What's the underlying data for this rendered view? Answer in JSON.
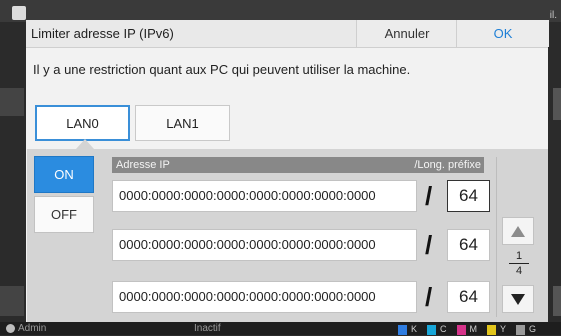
{
  "background": {
    "corner_text": "il."
  },
  "status_bar": {
    "user": "Admin",
    "state": "Inactif",
    "inks": [
      {
        "label": "K",
        "color": "#2f7de1"
      },
      {
        "label": "C",
        "color": "#18a6d8"
      },
      {
        "label": "M",
        "color": "#d6338a"
      },
      {
        "label": "Y",
        "color": "#e2c51b"
      },
      {
        "label": "G",
        "color": "#9a9a9a"
      }
    ]
  },
  "dialog": {
    "title": "Limiter adresse IP (IPv6)",
    "cancel_label": "Annuler",
    "ok_label": "OK",
    "message": "Il y a une restriction quant aux PC qui peuvent utiliser la machine.",
    "tabs": [
      {
        "label": "LAN0",
        "selected": true
      },
      {
        "label": "LAN1",
        "selected": false
      }
    ],
    "toggle": {
      "on_label": "ON",
      "off_label": "OFF",
      "value": "ON"
    },
    "list_header": {
      "ip_label": "Adresse IP",
      "prefix_label": "/Long. préfixe"
    },
    "rows": [
      {
        "ip": "0000:0000:0000:0000:0000:0000:0000:0000",
        "separator": "/",
        "prefix": "64"
      },
      {
        "ip": "0000:0000:0000:0000:0000:0000:0000:0000",
        "separator": "/",
        "prefix": "64"
      },
      {
        "ip": "0000:0000:0000:0000:0000:0000:0000:0000",
        "separator": "/",
        "prefix": "64"
      }
    ],
    "pager": {
      "current": "1",
      "total": "4"
    },
    "accent_color": "#2b8ce0"
  }
}
